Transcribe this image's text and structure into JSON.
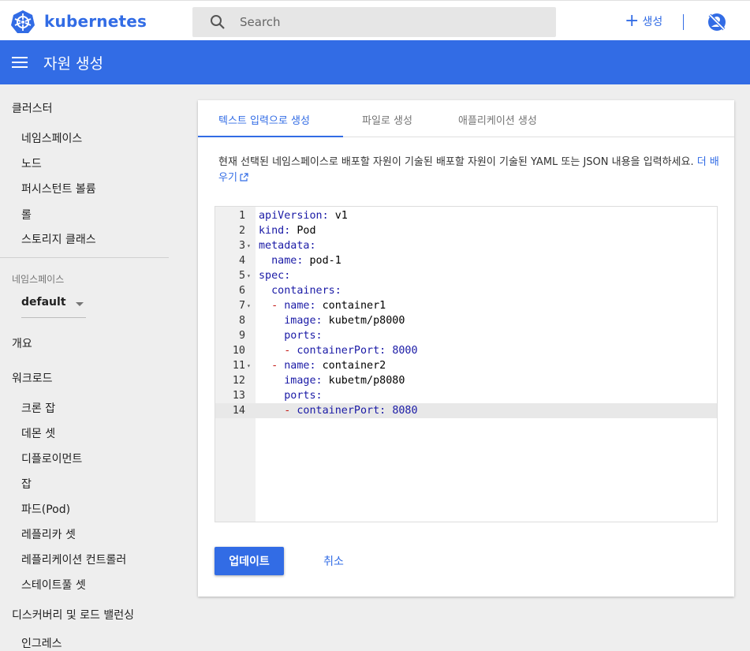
{
  "header": {
    "brand": "kubernetes",
    "search_placeholder": "Search",
    "create_label": "생성"
  },
  "titlebar": {
    "title": "자원 생성"
  },
  "sidebar": {
    "cluster_heading": "클러스터",
    "cluster_items": [
      "네임스페이스",
      "노드",
      "퍼시스턴트 볼륨",
      "롤",
      "스토리지 클래스"
    ],
    "namespace_label": "네임스페이스",
    "namespace_value": "default",
    "overview": "개요",
    "workloads_heading": "워크로드",
    "workload_items": [
      "크론 잡",
      "데몬 셋",
      "디플로이먼트",
      "잡",
      "파드(Pod)",
      "레플리카 셋",
      "레플리케이션 컨트롤러",
      "스테이트풀 셋"
    ],
    "discovery_heading": "디스커버리 및 로드 밸런싱",
    "discovery_items": [
      "인그레스"
    ]
  },
  "card": {
    "tabs": [
      "텍스트 입력으로 생성",
      "파일로 생성",
      "애플리케이션 생성"
    ],
    "active_tab": 0,
    "description": "현재 선택된 네임스페이스로 배포할 자원이 기술된 배포할 자원이 기술된 YAML 또는 JSON 내용을 입력하세요.",
    "learn_more": "더 배우기",
    "editor_lines": [
      "apiVersion: v1",
      "kind: Pod",
      "metadata:",
      "  name: pod-1",
      "spec:",
      "  containers:",
      "  - name: container1",
      "    image: kubetm/p8000",
      "    ports:",
      "    - containerPort: 8000",
      "  - name: container2",
      "    image: kubetm/p8080",
      "    ports:",
      "    - containerPort: 8080"
    ],
    "line_numbers": [
      "1",
      "2",
      "3",
      "4",
      "5",
      "6",
      "7",
      "8",
      "9",
      "10",
      "11",
      "12",
      "13",
      "14"
    ],
    "fold_lines": [
      3,
      5,
      7,
      11
    ],
    "active_line": 14,
    "update_label": "업데이트",
    "cancel_label": "취소"
  },
  "colors": {
    "accent": "#326ce5",
    "sidebar_bg": "#eeeeee"
  },
  "icons": [
    "kubernetes-logo-icon",
    "search-icon",
    "plus-icon",
    "user-hidden-icon",
    "menu-icon",
    "external-link-icon",
    "chevron-down-icon"
  ]
}
